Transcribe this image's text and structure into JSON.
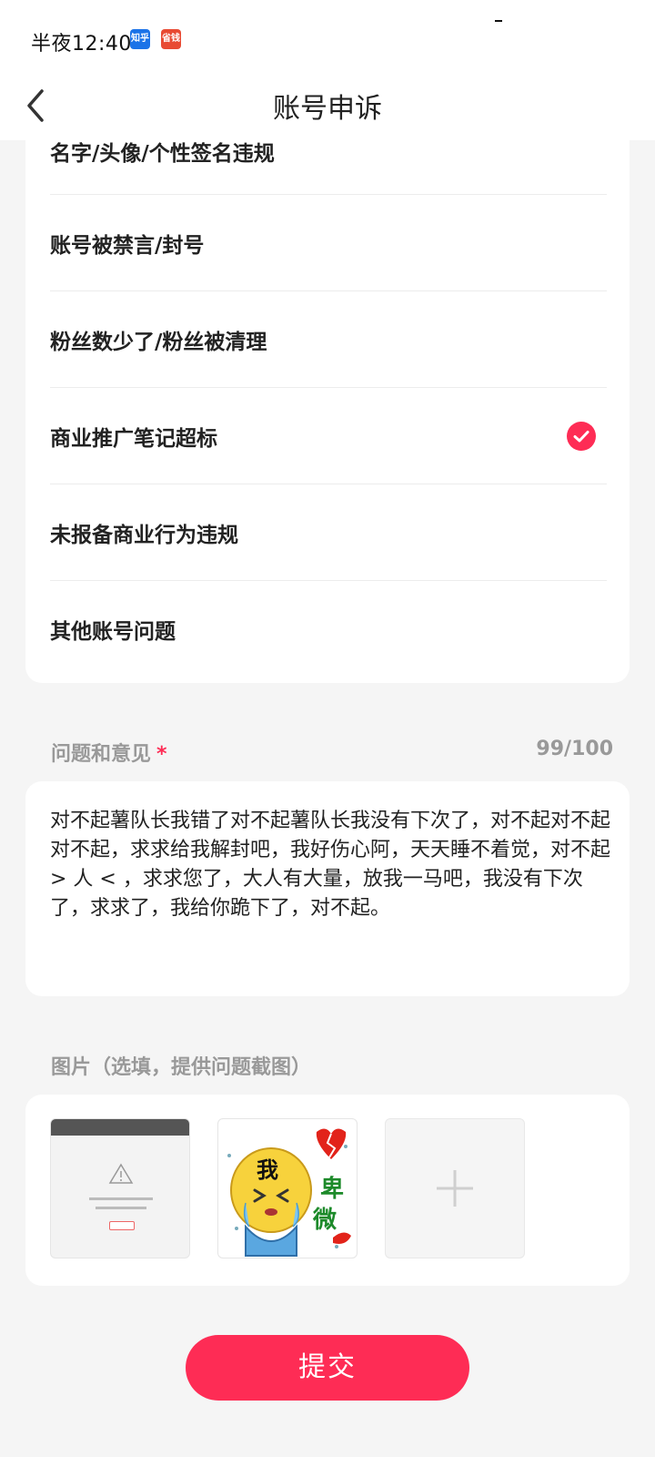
{
  "status_bar": {
    "time": "半夜12:40",
    "badges": [
      "知乎",
      "省钱"
    ]
  },
  "header": {
    "title": "账号申诉",
    "back_icon": "chevron-left-icon"
  },
  "reasons": [
    {
      "label": "名字/头像/个性签名违规",
      "selected": false
    },
    {
      "label": "账号被禁言/封号",
      "selected": false
    },
    {
      "label": "粉丝数少了/粉丝被清理",
      "selected": false
    },
    {
      "label": "商业推广笔记超标",
      "selected": true
    },
    {
      "label": "未报备商业行为违规",
      "selected": false
    },
    {
      "label": "其他账号问题",
      "selected": false
    }
  ],
  "feedback": {
    "label": "问题和意见",
    "required_mark": "*",
    "count": "99/100",
    "text": "对不起薯队长我错了对不起薯队长我没有下次了，对不起对不起对不起，求求给我解封吧，我好伤心阿，天天睡不着觉，对不起 > 人 < ，求求您了，大人有大量，放我一马吧，我没有下次了，求求了，我给你跪下了，对不起。"
  },
  "images": {
    "label": "图片（选填，提供问题截图）",
    "sticker_text_1": "我",
    "sticker_text_2": "卑",
    "sticker_text_3": "微",
    "add_icon": "plus-icon"
  },
  "submit": {
    "label": "提交"
  },
  "colors": {
    "accent": "#fe2c55",
    "background": "#f5f5f5",
    "card": "#ffffff",
    "muted_text": "#999999"
  }
}
